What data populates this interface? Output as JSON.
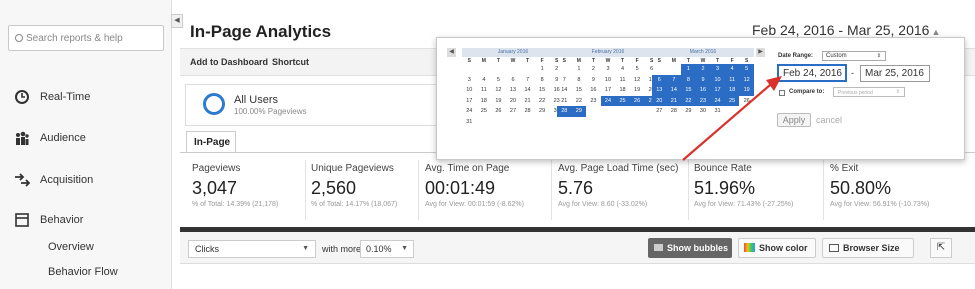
{
  "sidebar": {
    "search_placeholder": "Search reports & help",
    "items": [
      {
        "label": "Real-Time",
        "icon": "clock-icon"
      },
      {
        "label": "Audience",
        "icon": "people-icon"
      },
      {
        "label": "Acquisition",
        "icon": "arrows-icon"
      },
      {
        "label": "Behavior",
        "icon": "window-icon"
      }
    ],
    "sub_items": [
      "Overview",
      "Behavior Flow"
    ]
  },
  "header": {
    "title": "In-Page Analytics",
    "add_to_dashboard": "Add to Dashboard",
    "shortcut": "Shortcut",
    "date_range": "Feb 24, 2016 - Mar 25, 2016"
  },
  "segment": {
    "name": "All Users",
    "sub": "100.00% Pageviews"
  },
  "tab": {
    "label": "In-Page"
  },
  "metrics": [
    {
      "label": "Pageviews",
      "value": "3,047",
      "sub": "% of Total: 14.39% (21,178)"
    },
    {
      "label": "Unique Pageviews",
      "value": "2,560",
      "sub": "% of Total: 14.17% (18,067)"
    },
    {
      "label": "Avg. Time on Page",
      "value": "00:01:49",
      "sub": "Avg for View: 00:01:59 (-8.62%)"
    },
    {
      "label": "Avg. Page Load Time (sec)",
      "value": "5.76",
      "sub": "Avg for View: 8.60 (-33.02%)"
    },
    {
      "label": "Bounce Rate",
      "value": "51.96%",
      "sub": "Avg for View: 71.43% (-27.25%)"
    },
    {
      "label": "% Exit",
      "value": "50.80%",
      "sub": "Avg for View: 56.91% (-10.73%)"
    }
  ],
  "controls": {
    "clicks": "Clicks",
    "with_more_than": "with more than:",
    "threshold": "0.10%",
    "show_bubbles": "Show bubbles",
    "show_color": "Show color",
    "browser_size": "Browser Size",
    "expand": "⇱"
  },
  "picker": {
    "weekdays": [
      "S",
      "M",
      "T",
      "W",
      "T",
      "F",
      "S"
    ],
    "months": [
      {
        "name": "January 2016",
        "days": [
          "",
          "",
          "",
          "",
          "",
          "1",
          "2",
          "3",
          "4",
          "5",
          "6",
          "7",
          "8",
          "9",
          "10",
          "11",
          "12",
          "13",
          "14",
          "15",
          "16",
          "17",
          "18",
          "19",
          "20",
          "21",
          "22",
          "23",
          "24",
          "25",
          "26",
          "27",
          "28",
          "29",
          "30",
          "31"
        ],
        "selected_from": 99,
        "selected_to": 99
      },
      {
        "name": "February 2016",
        "days": [
          "",
          "1",
          "2",
          "3",
          "4",
          "5",
          "6",
          "7",
          "8",
          "9",
          "10",
          "11",
          "12",
          "13",
          "14",
          "15",
          "16",
          "17",
          "18",
          "19",
          "20",
          "21",
          "22",
          "23",
          "24",
          "25",
          "26",
          "27",
          "28",
          "29"
        ],
        "selected_from": 24,
        "selected_to": 29
      },
      {
        "name": "March 2016",
        "days": [
          "",
          "",
          "1",
          "2",
          "3",
          "4",
          "5",
          "6",
          "7",
          "8",
          "9",
          "10",
          "11",
          "12",
          "13",
          "14",
          "15",
          "16",
          "17",
          "18",
          "19",
          "20",
          "21",
          "22",
          "23",
          "24",
          "25",
          "26",
          "27",
          "28",
          "29",
          "30",
          "31"
        ],
        "selected_from": 1,
        "selected_to": 25
      }
    ],
    "date_range_label": "Date Range:",
    "date_range_value": "Custom",
    "start": "Feb 24, 2016",
    "separator": "-",
    "end": "Mar 25, 2016",
    "compare_label": "Compare to:",
    "compare_value": "Previous period",
    "apply": "Apply",
    "cancel": "cancel"
  },
  "colors": {
    "accent": "#2b6cc4",
    "arrow": "#d9312b"
  }
}
